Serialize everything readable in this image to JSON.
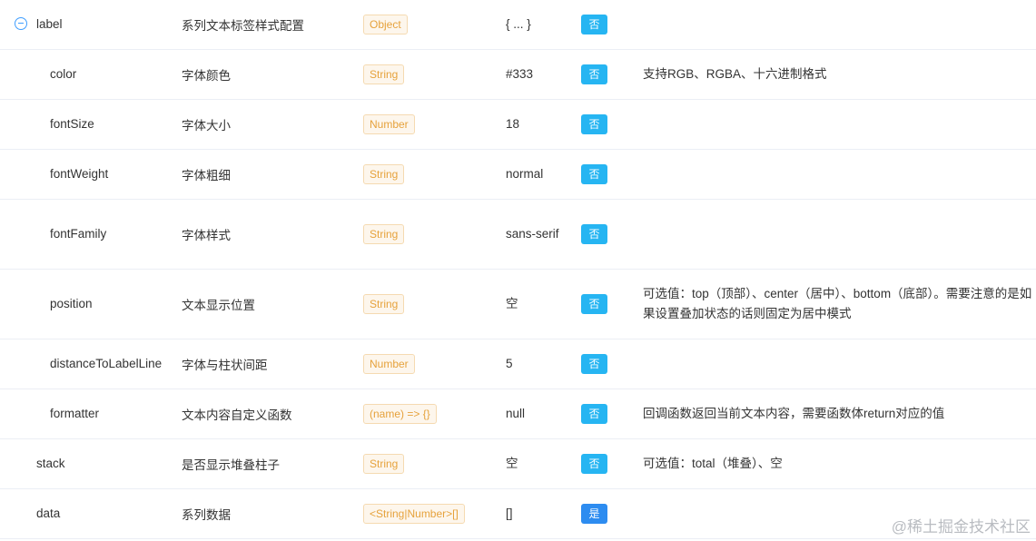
{
  "rows": [
    {
      "name": "label",
      "desc": "系列文本标签样式配置",
      "type": "Object",
      "default": "{ ... }",
      "required": "否",
      "note": ""
    },
    {
      "name": "color",
      "desc": "字体颜色",
      "type": "String",
      "default": "#333",
      "required": "否",
      "note": "支持RGB、RGBA、十六进制格式"
    },
    {
      "name": "fontSize",
      "desc": "字体大小",
      "type": "Number",
      "default": "18",
      "required": "否",
      "note": ""
    },
    {
      "name": "fontWeight",
      "desc": "字体粗细",
      "type": "String",
      "default": "normal",
      "required": "否",
      "note": ""
    },
    {
      "name": "fontFamily",
      "desc": "字体样式",
      "type": "String",
      "default": "sans-serif",
      "required": "否",
      "note": ""
    },
    {
      "name": "position",
      "desc": "文本显示位置",
      "type": "String",
      "default": "空",
      "required": "否",
      "note": "可选值：top（顶部）、center（居中）、bottom（底部）。需要注意的是如果设置叠加状态的话则固定为居中模式"
    },
    {
      "name": "distanceToLabelLine",
      "desc": "字体与柱状间距",
      "type": "Number",
      "default": "5",
      "required": "否",
      "note": ""
    },
    {
      "name": "formatter",
      "desc": "文本内容自定义函数",
      "type": "(name) => {}",
      "default": "null",
      "required": "否",
      "note": "回调函数返回当前文本内容，需要函数体return对应的值"
    },
    {
      "name": "stack",
      "desc": "是否显示堆叠柱子",
      "type": "String",
      "default": "空",
      "required": "否",
      "note": "可选值：total（堆叠）、空"
    },
    {
      "name": "data",
      "desc": "系列数据",
      "type": "<String|Number>[]",
      "default": "[]",
      "required": "是",
      "note": ""
    }
  ],
  "watermark": "@稀土掘金技术社区",
  "colors": {
    "tag_text": "#e6a23c",
    "tag_bg": "#fdf6ec",
    "tag_border": "#f5dab1",
    "required_no": "#26b5f2",
    "required_yes": "#2d8cf0",
    "expand_icon": "#409eff",
    "row_border": "#ebeef5"
  },
  "icons": {
    "expand": "collapse-minus-icon"
  }
}
